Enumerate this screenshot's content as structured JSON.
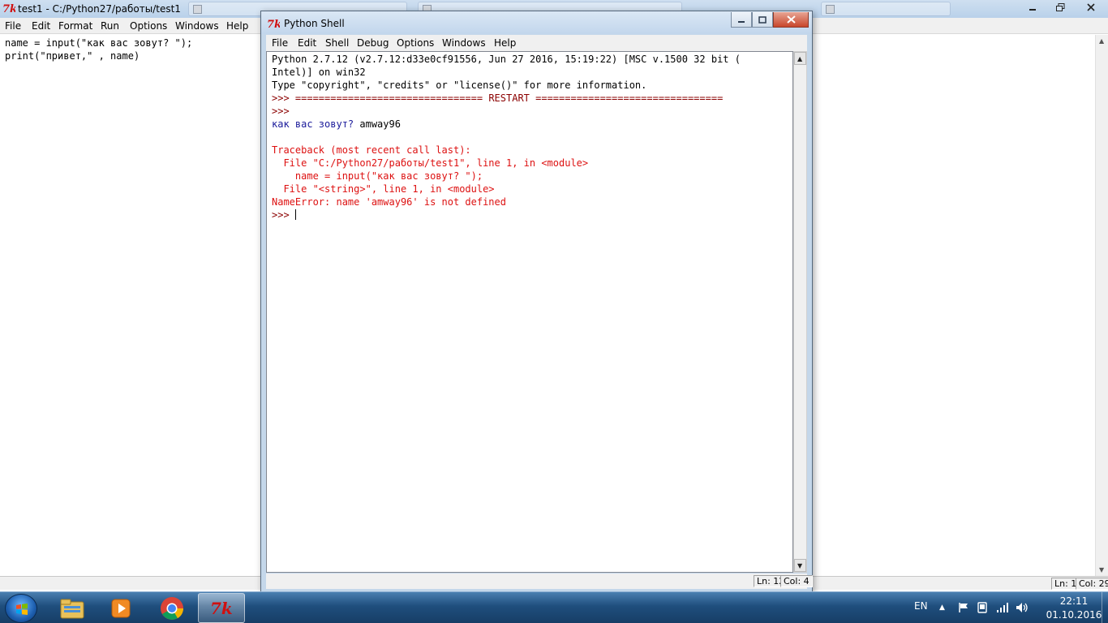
{
  "editor_window": {
    "title": "test1 - C:/Python27/работы/test1",
    "menu": [
      "File",
      "Edit",
      "Format",
      "Run",
      "Options",
      "Windows",
      "Help"
    ],
    "code_lines": [
      "name = input(\"как вас зовут? \");",
      "print(\"привет,\" , name)"
    ],
    "status": {
      "line": "Ln: 1",
      "col": "Col: 29"
    }
  },
  "shell_window": {
    "title": "Python Shell",
    "menu": [
      "File",
      "Edit",
      "Shell",
      "Debug",
      "Options",
      "Windows",
      "Help"
    ],
    "lines": [
      "Python 2.7.12 (v2.7.12:d33e0cf91556, Jun 27 2016, 15:19:22) [MSC v.1500 32 bit (",
      "Intel)] on win32",
      "Type \"copyright\", \"credits\" or \"license()\" for more information.",
      ">>> ",
      "================================ RESTART ================================",
      ">>> ",
      "как вас зовут? ",
      "amway96",
      "Traceback (most recent call last):",
      "  File \"C:/Python27/работы/test1\", line 1, in <module>",
      "    name = input(\"как вас зовут? \");",
      "  File \"<string>\", line 1, in <module>",
      "NameError: name 'amway96' is not defined",
      ">>> "
    ],
    "status": {
      "line": "Ln: 12",
      "col": "Col: 4"
    },
    "colors": {
      "prompt": "#8b0000",
      "stdout": "#1a1a9a",
      "error": "#dd1111"
    }
  },
  "taskbar": {
    "apps": [
      "windows-explorer",
      "media-player",
      "chrome",
      "idle-tk"
    ],
    "active_app": "idle-tk",
    "tray": {
      "language": "EN"
    },
    "clock": {
      "time": "22:11",
      "date": "01.10.2016"
    }
  }
}
